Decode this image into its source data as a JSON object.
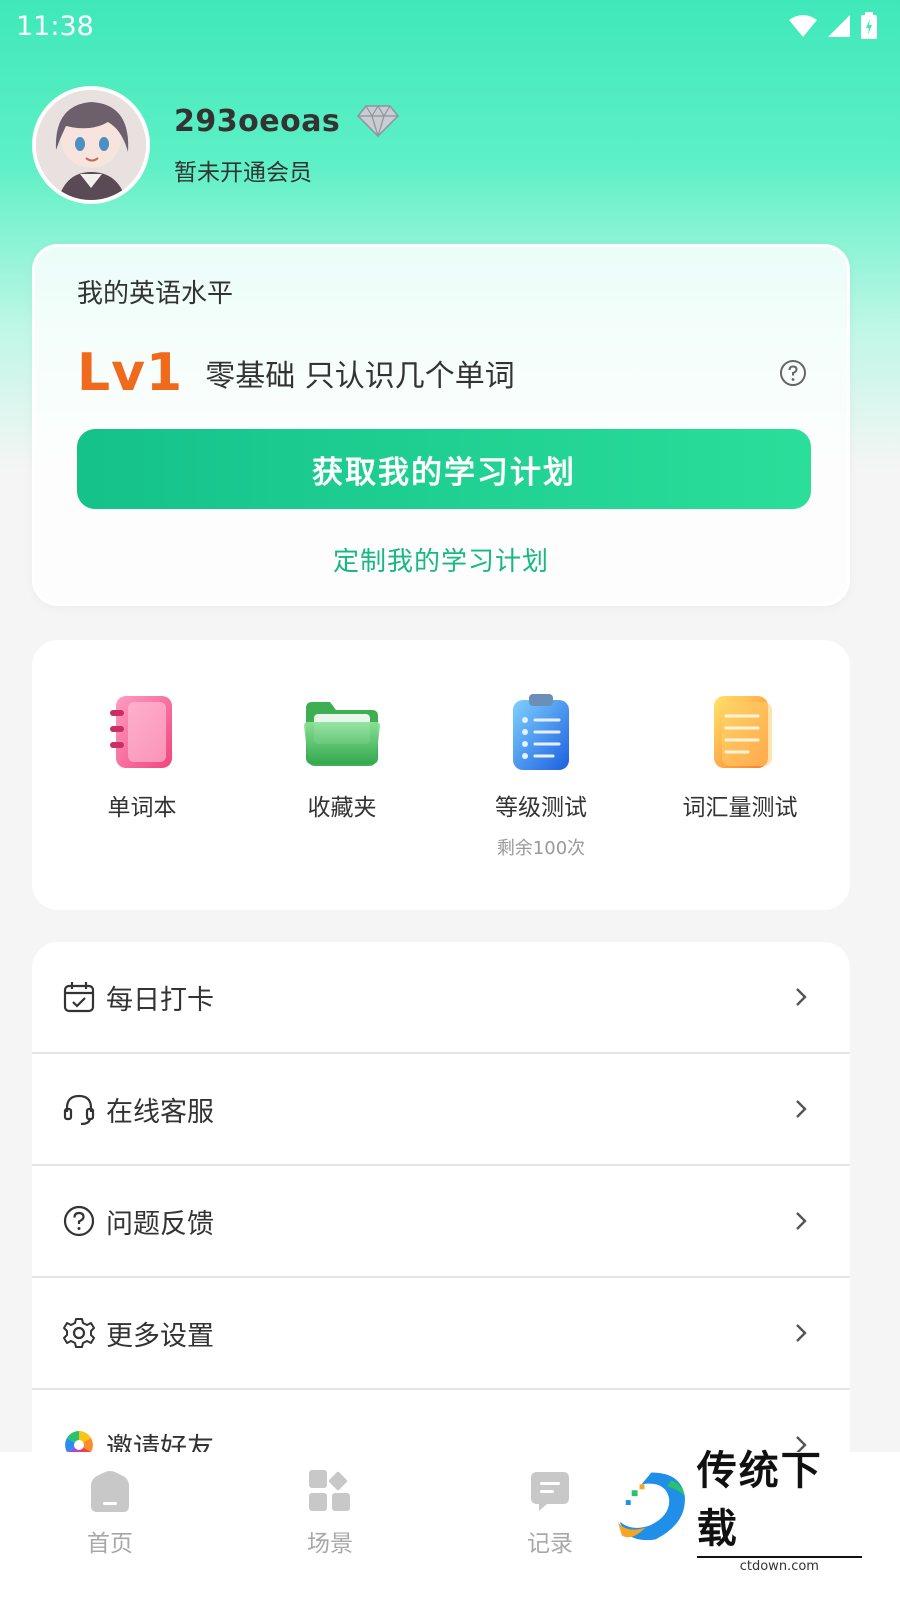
{
  "status_bar": {
    "time": "11:38"
  },
  "profile": {
    "username": "293oeoas",
    "membership": "暂未开通会员"
  },
  "level_card": {
    "title": "我的英语水平",
    "level": "Lv1",
    "description": "零基础 只认识几个单词",
    "primary_button": "获取我的学习计划",
    "secondary_link": "定制我的学习计划"
  },
  "tools": [
    {
      "label": "单词本",
      "icon": "notebook-icon"
    },
    {
      "label": "收藏夹",
      "icon": "folder-icon"
    },
    {
      "label": "等级测试",
      "sub": "剩余100次",
      "icon": "clipboard-icon"
    },
    {
      "label": "词汇量测试",
      "icon": "document-icon"
    }
  ],
  "menu": [
    {
      "label": "每日打卡",
      "icon": "calendar-check-icon"
    },
    {
      "label": "在线客服",
      "icon": "headset-icon"
    },
    {
      "label": "问题反馈",
      "icon": "question-circle-icon"
    },
    {
      "label": "更多设置",
      "icon": "gear-icon"
    },
    {
      "label": "邀请好友",
      "icon": "color-wheel-icon"
    }
  ],
  "tabbar": [
    {
      "label": "首页",
      "icon": "home-icon"
    },
    {
      "label": "场景",
      "icon": "grid-icon"
    },
    {
      "label": "记录",
      "icon": "chat-icon"
    }
  ],
  "watermark": {
    "title": "传统下载",
    "subtitle": "ctdown.com"
  },
  "colors": {
    "accent": "#17b884",
    "level": "#f06a1d",
    "background": "#f5f5f5"
  }
}
